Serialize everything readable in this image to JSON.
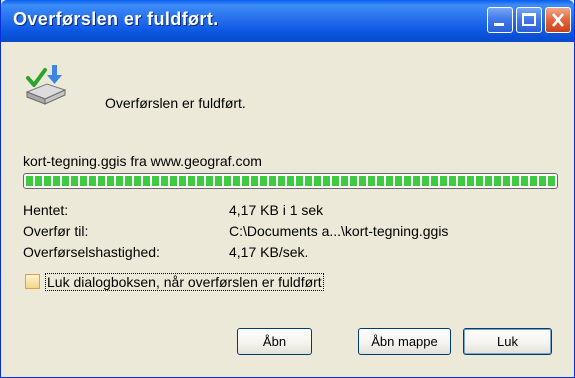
{
  "window": {
    "title": "Overførslen er fuldført."
  },
  "status": {
    "message": "Overførslen er fuldført."
  },
  "source": "kort-tegning.ggis fra www.geograf.com",
  "progress": {
    "fraction": 1.0
  },
  "details": [
    {
      "label": "Hentet:",
      "value": "4,17 KB i 1 sek"
    },
    {
      "label": "Overfør til:",
      "value": "C:\\Documents a...\\kort-tegning.ggis"
    },
    {
      "label": "Overførselshastighed:",
      "value": "4,17 KB/sek."
    }
  ],
  "close_on_complete": {
    "label": "Luk dialogboksen, når overførslen er fuldført",
    "checked": false
  },
  "buttons": {
    "open": "Åbn",
    "open_folder": "Åbn mappe",
    "close": "Luk"
  }
}
